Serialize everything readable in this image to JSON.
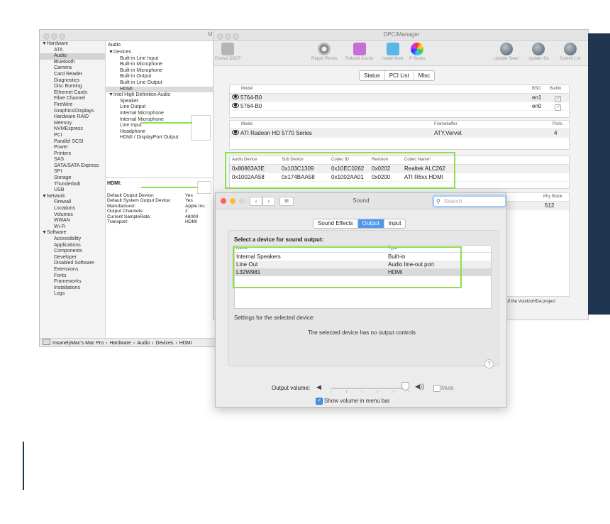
{
  "sysinfo": {
    "title_fragment": "M",
    "sidebar": [
      {
        "label": "▼Hardware",
        "type": "group"
      },
      {
        "label": "ATA",
        "type": "child"
      },
      {
        "label": "Audio",
        "type": "child",
        "selected": true
      },
      {
        "label": "Bluetooth",
        "type": "child"
      },
      {
        "label": "Camera",
        "type": "child"
      },
      {
        "label": "Card Reader",
        "type": "child"
      },
      {
        "label": "Diagnostics",
        "type": "child"
      },
      {
        "label": "Disc Burning",
        "type": "child"
      },
      {
        "label": "Ethernet Cards",
        "type": "child"
      },
      {
        "label": "Fibre Channel",
        "type": "child"
      },
      {
        "label": "FireWire",
        "type": "child"
      },
      {
        "label": "Graphics/Displays",
        "type": "child"
      },
      {
        "label": "Hardware RAID",
        "type": "child"
      },
      {
        "label": "Memory",
        "type": "child"
      },
      {
        "label": "NVMExpress",
        "type": "child"
      },
      {
        "label": "PCI",
        "type": "child"
      },
      {
        "label": "Parallel SCSI",
        "type": "child"
      },
      {
        "label": "Power",
        "type": "child"
      },
      {
        "label": "Printers",
        "type": "child"
      },
      {
        "label": "SAS",
        "type": "child"
      },
      {
        "label": "SATA/SATA Express",
        "type": "child"
      },
      {
        "label": "SPI",
        "type": "child"
      },
      {
        "label": "Storage",
        "type": "child"
      },
      {
        "label": "Thunderbolt",
        "type": "child"
      },
      {
        "label": "USB",
        "type": "child"
      },
      {
        "label": "▼Network",
        "type": "group"
      },
      {
        "label": "Firewall",
        "type": "child"
      },
      {
        "label": "Locations",
        "type": "child"
      },
      {
        "label": "Volumes",
        "type": "child"
      },
      {
        "label": "WWAN",
        "type": "child"
      },
      {
        "label": "Wi-Fi",
        "type": "child"
      },
      {
        "label": "▼Software",
        "type": "group"
      },
      {
        "label": "Accessibility",
        "type": "child"
      },
      {
        "label": "Applications",
        "type": "child"
      },
      {
        "label": "Components",
        "type": "child"
      },
      {
        "label": "Developer",
        "type": "child"
      },
      {
        "label": "Disabled Software",
        "type": "child"
      },
      {
        "label": "Extensions",
        "type": "child"
      },
      {
        "label": "Fonts",
        "type": "child"
      },
      {
        "label": "Frameworks",
        "type": "child"
      },
      {
        "label": "Installations",
        "type": "child"
      },
      {
        "label": "Logs",
        "type": "child"
      }
    ],
    "content_heading": "Audio",
    "devices": [
      {
        "label": "▼Devices",
        "type": "group"
      },
      {
        "label": "Built-in Line Input",
        "type": "child"
      },
      {
        "label": "Built-in Microphone",
        "type": "child"
      },
      {
        "label": "Built-in Microphone",
        "type": "child"
      },
      {
        "label": "Built-in Output",
        "type": "child"
      },
      {
        "label": "Built-in Line Output",
        "type": "child"
      },
      {
        "label": "HDMI",
        "type": "child",
        "selected": true
      },
      {
        "label": "▼Intel High Definition Audio",
        "type": "group"
      },
      {
        "label": "Speaker",
        "type": "child"
      },
      {
        "label": "Line Output",
        "type": "child"
      },
      {
        "label": "Internal Microphone",
        "type": "child"
      },
      {
        "label": "Internal Microphone",
        "type": "child"
      },
      {
        "label": "Line Input",
        "type": "child"
      },
      {
        "label": "Headphone",
        "type": "child"
      },
      {
        "label": "HDMI / DisplayPort Output",
        "type": "child"
      }
    ],
    "detail_title": "HDMI:",
    "detail_props": [
      {
        "key": "Default Output Device:",
        "value": "Yes"
      },
      {
        "key": "Default System Output Device:",
        "value": "Yes"
      },
      {
        "key": "Manufacturer:",
        "value": "Apple Inc."
      },
      {
        "key": "Output Channels:",
        "value": "2"
      },
      {
        "key": "Current SampleRate:",
        "value": "48000"
      },
      {
        "key": "Transport:",
        "value": "HDMI"
      }
    ],
    "path": [
      "InsanelyMac's Mac Pro",
      "Hardware",
      "Audio",
      "Devices",
      "HDMI"
    ],
    "path_sep": "›"
  },
  "dpci": {
    "title": "DPCIManager",
    "toolbar": [
      {
        "label": "Extract DSDT",
        "icon": "sq"
      },
      {
        "label": "Repair Perms",
        "icon": "gear"
      },
      {
        "label": "Rebuild Cache",
        "icon": "pink"
      },
      {
        "label": "Install Kext",
        "icon": "cyan"
      },
      {
        "label": "P States",
        "icon": "wheel"
      },
      {
        "label": "Update Seed",
        "icon": "globe"
      },
      {
        "label": "Update IDs",
        "icon": "globe"
      },
      {
        "label": "Submit List",
        "icon": "globe"
      }
    ],
    "tabs": [
      "Status",
      "PCI List",
      "Misc"
    ],
    "ethernet": {
      "headers": {
        "model": "Model",
        "bsd": "BSD",
        "builtin": "Builtin"
      },
      "rows": [
        {
          "model": "5764-B0",
          "bsd": "en1",
          "builtin": "✓"
        },
        {
          "model": "5764-B0",
          "bsd": "en0",
          "builtin": "✓"
        }
      ]
    },
    "graphics": {
      "headers": {
        "model": "Model",
        "framebuffer": "Framebuffer",
        "ports": "Ports"
      },
      "rows": [
        {
          "model": "ATI Radeon HD 5770 Series",
          "framebuffer": "ATY,Vervet",
          "ports": "4"
        }
      ]
    },
    "audio": {
      "headers": {
        "device": "Audio Device",
        "sub": "Sub Device",
        "codec": "Codec ID",
        "rev": "Revision",
        "name": "Codec Name*"
      },
      "rows": [
        {
          "device": "0x80863A3E",
          "sub": "0x103C1309",
          "codec": "0x10EC0262",
          "rev": "0x0202",
          "name": "Realtek ALC262"
        },
        {
          "device": "0x1002AA58",
          "sub": "0x174BAA58",
          "codec": "0x1002AA01",
          "rev": "0x0200",
          "name": "ATI R6xx HDMI"
        }
      ]
    },
    "partial_header": "Phy Block",
    "partial_value": "512",
    "footer_text": "of the VoodooHDA project"
  },
  "sound": {
    "title": "Sound",
    "search_placeholder": "Search",
    "search_icon": "magnifier-icon",
    "tabs": [
      "Sound Effects",
      "Output",
      "Input"
    ],
    "active_tab": "Output",
    "select_label": "Select a device for sound output:",
    "table_headers": {
      "name": "Name",
      "type": "Type"
    },
    "devices": [
      {
        "name": "Internal Speakers",
        "type": "Built-in"
      },
      {
        "name": "Line Out",
        "type": "Audio line-out port"
      },
      {
        "name": "L32W981",
        "type": "HDMI",
        "selected": true
      }
    ],
    "settings_label": "Settings for the selected device:",
    "no_controls": "The selected device has no output controls",
    "help": "?",
    "volume_label": "Output volume:",
    "volume_level": 0.95,
    "mute_label": "Mute",
    "mute_checked": false,
    "show_volume_label": "Show volume in menu bar",
    "show_volume_checked": true
  },
  "colors": {
    "highlight": "#8be04e",
    "accent": "#4f98ee",
    "close": "#fe5f57",
    "minimize": "#febc2e",
    "zoom_inactive": "#d6d6d6",
    "sidebar_bar": "#1f3550"
  }
}
